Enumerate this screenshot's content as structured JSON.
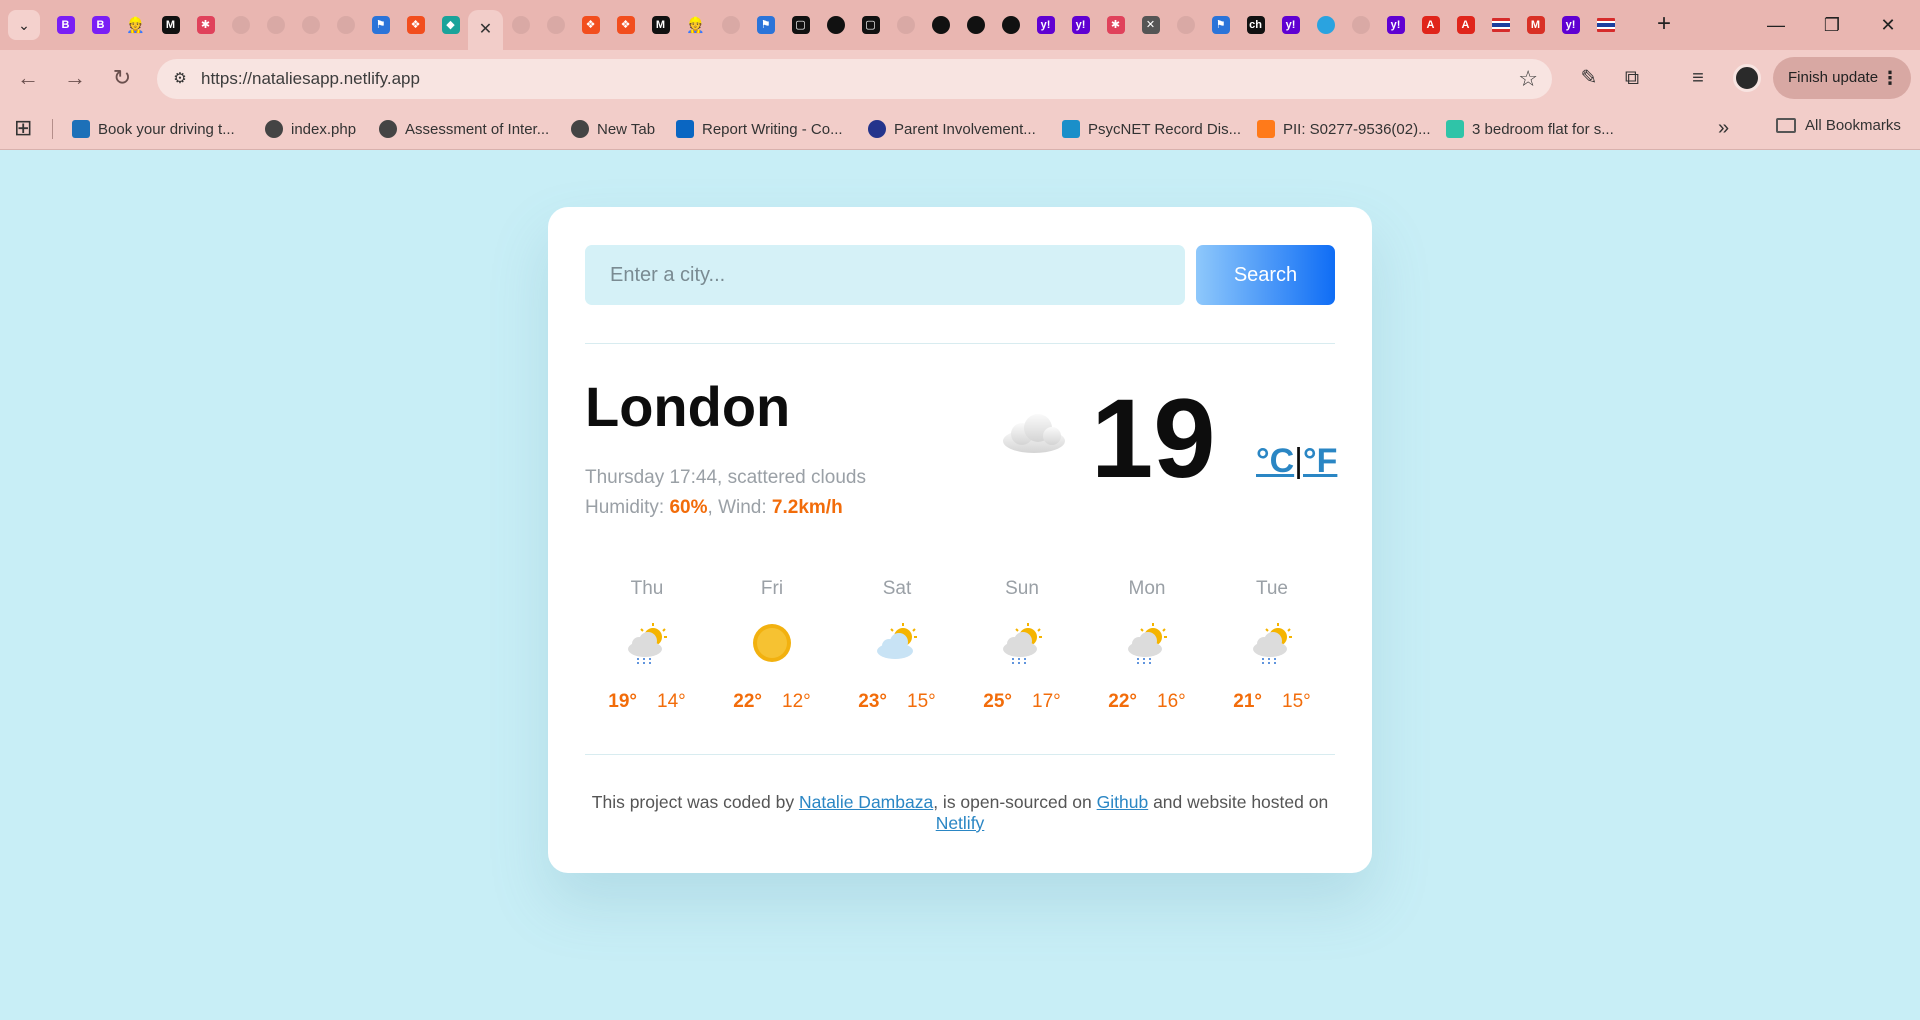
{
  "browser": {
    "url": "https://nataliesapp.netlify.app",
    "finish_update_label": "Finish update",
    "new_tab_glyph": "+",
    "tabs": [
      {
        "icon": "bootstrap-icon",
        "glyph": "B",
        "color": "#7a1ff5"
      },
      {
        "icon": "bootstrap-icon",
        "glyph": "B",
        "color": "#7a1ff5"
      },
      {
        "icon": "person-emoji-icon",
        "glyph": "👷",
        "color": "#e9b6b1"
      },
      {
        "icon": "medium-m-icon",
        "glyph": "M",
        "color": "#111111"
      },
      {
        "icon": "slack-icon",
        "glyph": "✱",
        "color": "#e0425b"
      },
      {
        "icon": "globe-icon",
        "glyph": "",
        "color": "globe"
      },
      {
        "icon": "globe-icon",
        "glyph": "",
        "color": "globe"
      },
      {
        "icon": "globe-icon",
        "glyph": "",
        "color": "globe"
      },
      {
        "icon": "globe-icon",
        "glyph": "",
        "color": "globe"
      },
      {
        "icon": "flag-icon",
        "glyph": "⚑",
        "color": "#2b74d9"
      },
      {
        "icon": "figma-icon",
        "glyph": "❖",
        "color": "#f24e1e"
      },
      {
        "icon": "diamond-icon",
        "glyph": "◆",
        "color": "#1aa39a"
      },
      {
        "icon": "close-icon",
        "glyph": "✕",
        "color": "active"
      },
      {
        "icon": "globe-icon",
        "glyph": "",
        "color": "globe"
      },
      {
        "icon": "globe-icon",
        "glyph": "",
        "color": "globe"
      },
      {
        "icon": "figma-icon",
        "glyph": "❖",
        "color": "#f24e1e"
      },
      {
        "icon": "figma-icon",
        "glyph": "❖",
        "color": "#f24e1e"
      },
      {
        "icon": "medium-m-icon",
        "glyph": "M",
        "color": "#111111"
      },
      {
        "icon": "person-emoji-icon",
        "glyph": "👷",
        "color": "#e9b6b1"
      },
      {
        "icon": "globe-icon",
        "glyph": "",
        "color": "globe"
      },
      {
        "icon": "flag-icon",
        "glyph": "⚑",
        "color": "#2b74d9"
      },
      {
        "icon": "square-icon",
        "glyph": "▢",
        "color": "#111111"
      },
      {
        "icon": "github-icon",
        "glyph": "●",
        "color": "#111111"
      },
      {
        "icon": "square-icon",
        "glyph": "▢",
        "color": "#111111"
      },
      {
        "icon": "globe-icon",
        "glyph": "",
        "color": "globe"
      },
      {
        "icon": "github-icon",
        "glyph": "●",
        "color": "#111111"
      },
      {
        "icon": "github-icon",
        "glyph": "●",
        "color": "#111111"
      },
      {
        "icon": "github-icon",
        "glyph": "●",
        "color": "#111111"
      },
      {
        "icon": "yahoo-icon",
        "glyph": "y!",
        "color": "#6001d2"
      },
      {
        "icon": "yahoo-icon",
        "glyph": "y!",
        "color": "#6001d2"
      },
      {
        "icon": "slack-icon",
        "glyph": "✱",
        "color": "#e0425b"
      },
      {
        "icon": "vscode-icon",
        "glyph": "✕",
        "color": "#555555"
      },
      {
        "icon": "globe-icon",
        "glyph": "",
        "color": "globe"
      },
      {
        "icon": "flag-icon",
        "glyph": "⚑",
        "color": "#2b74d9"
      },
      {
        "icon": "ch-icon",
        "glyph": "ch",
        "color": "#111111"
      },
      {
        "icon": "yahoo-icon",
        "glyph": "y!",
        "color": "#6001d2"
      },
      {
        "icon": "telegram-icon",
        "glyph": "➤",
        "color": "#2aa3e0"
      },
      {
        "icon": "globe-icon",
        "glyph": "",
        "color": "globe"
      },
      {
        "icon": "yahoo-icon",
        "glyph": "y!",
        "color": "#6001d2"
      },
      {
        "icon": "acrobat-icon",
        "glyph": "A",
        "color": "#e0251b"
      },
      {
        "icon": "acrobat-icon",
        "glyph": "A",
        "color": "#e0251b"
      },
      {
        "icon": "flag-thai-icon",
        "glyph": "",
        "color": "#1d3f9e"
      },
      {
        "icon": "gmail-icon",
        "glyph": "M",
        "color": "#d93025"
      },
      {
        "icon": "yahoo-icon",
        "glyph": "y!",
        "color": "#6001d2"
      },
      {
        "icon": "flag-thai-icon",
        "glyph": "",
        "color": "#1d3f9e"
      }
    ],
    "bookmarks": [
      {
        "icon": "driving-icon",
        "label": "Book your driving t...",
        "color": "#1d70b8"
      },
      {
        "icon": "globe-icon",
        "label": "index.php",
        "color": "#444444"
      },
      {
        "icon": "globe-icon",
        "label": "Assessment of Inter...",
        "color": "#444444"
      },
      {
        "icon": "globe-icon",
        "label": "New Tab",
        "color": "#444444"
      },
      {
        "icon": "linkedin-icon",
        "label": "Report Writing - Co...",
        "color": "#0a66c2"
      },
      {
        "icon": "scholar-icon",
        "label": "Parent Involvement...",
        "color": "#24348c"
      },
      {
        "icon": "psycnet-icon",
        "label": "PsycNET Record Dis...",
        "color": "#1a8fc9"
      },
      {
        "icon": "elsevier-icon",
        "label": "PII: S0277-9536(02)...",
        "color": "#ff7a1a"
      },
      {
        "icon": "home-icon",
        "label": "3 bedroom flat for s...",
        "color": "#2fc4a8"
      }
    ],
    "all_bookmarks_label": "All Bookmarks"
  },
  "search": {
    "placeholder": "Enter a city...",
    "button_label": "Search"
  },
  "current": {
    "city": "London",
    "datetime": "Thursday 17:44",
    "description": "scattered clouds",
    "humidity_label": "Humidity:",
    "humidity_value": "60%",
    "wind_label": "Wind:",
    "wind_value": "7.2km/h",
    "temperature": "19",
    "icon": "cloud-icon",
    "unit_c": "°C",
    "unit_sep": "|",
    "unit_f": "°F"
  },
  "forecast": [
    {
      "day": "Thu",
      "icon": "sun-cloud-rain-icon",
      "max": "19°",
      "min": "14°"
    },
    {
      "day": "Fri",
      "icon": "sun-icon",
      "max": "22°",
      "min": "12°"
    },
    {
      "day": "Sat",
      "icon": "sun-cloud-icon",
      "max": "23°",
      "min": "15°"
    },
    {
      "day": "Sun",
      "icon": "sun-cloud-rain-icon",
      "max": "25°",
      "min": "17°"
    },
    {
      "day": "Mon",
      "icon": "sun-cloud-rain-icon",
      "max": "22°",
      "min": "16°"
    },
    {
      "day": "Tue",
      "icon": "sun-cloud-rain-icon",
      "max": "21°",
      "min": "15°"
    }
  ],
  "footer": {
    "text_1": "This project was coded by ",
    "author": "Natalie Dambaza",
    "text_2": ", is open-sourced on ",
    "github": "Github",
    "text_3": " and website hosted on ",
    "netlify": "Netlify"
  },
  "colors": {
    "page_bg": "#c8eef6",
    "accent_orange": "#f26c0a",
    "link_blue": "#2a86c4",
    "browser_frame": "#e9b6b1"
  }
}
